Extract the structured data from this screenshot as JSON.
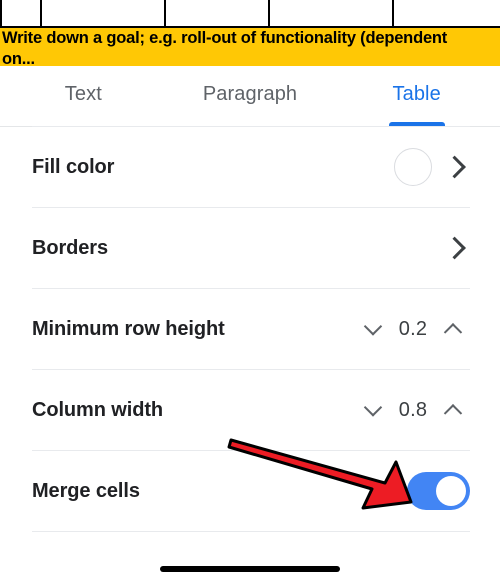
{
  "document_preview": {
    "highlight_color": "#FFC805",
    "highlight_text_line1": "Write down a goal; e.g. roll-out of functionality (dependent",
    "highlight_text_line2": "on...",
    "table_columns": 5
  },
  "tabs": {
    "active_color": "#1a73e8",
    "inactive_color": "#5f6368",
    "items": [
      {
        "label": "Text",
        "active": false
      },
      {
        "label": "Paragraph",
        "active": false
      },
      {
        "label": "Table",
        "active": true
      }
    ]
  },
  "settings": {
    "fill_color": {
      "label": "Fill color",
      "swatch_color": "#ffffff",
      "chevron": "chevron-right-icon"
    },
    "borders": {
      "label": "Borders",
      "chevron": "chevron-right-icon"
    },
    "minimum_row_height": {
      "label": "Minimum row height",
      "value": "0.2",
      "decrement_icon": "chevron-down-icon",
      "increment_icon": "chevron-up-icon"
    },
    "column_width": {
      "label": "Column width",
      "value": "0.8",
      "decrement_icon": "chevron-down-icon",
      "increment_icon": "chevron-up-icon"
    },
    "merge_cells": {
      "label": "Merge cells",
      "enabled": true,
      "toggle_on_color": "#4285f4"
    }
  },
  "annotation": {
    "type": "arrow",
    "fill_color": "#ED1C24",
    "stroke_color": "#000000",
    "points_to": "merge-cells-toggle"
  }
}
